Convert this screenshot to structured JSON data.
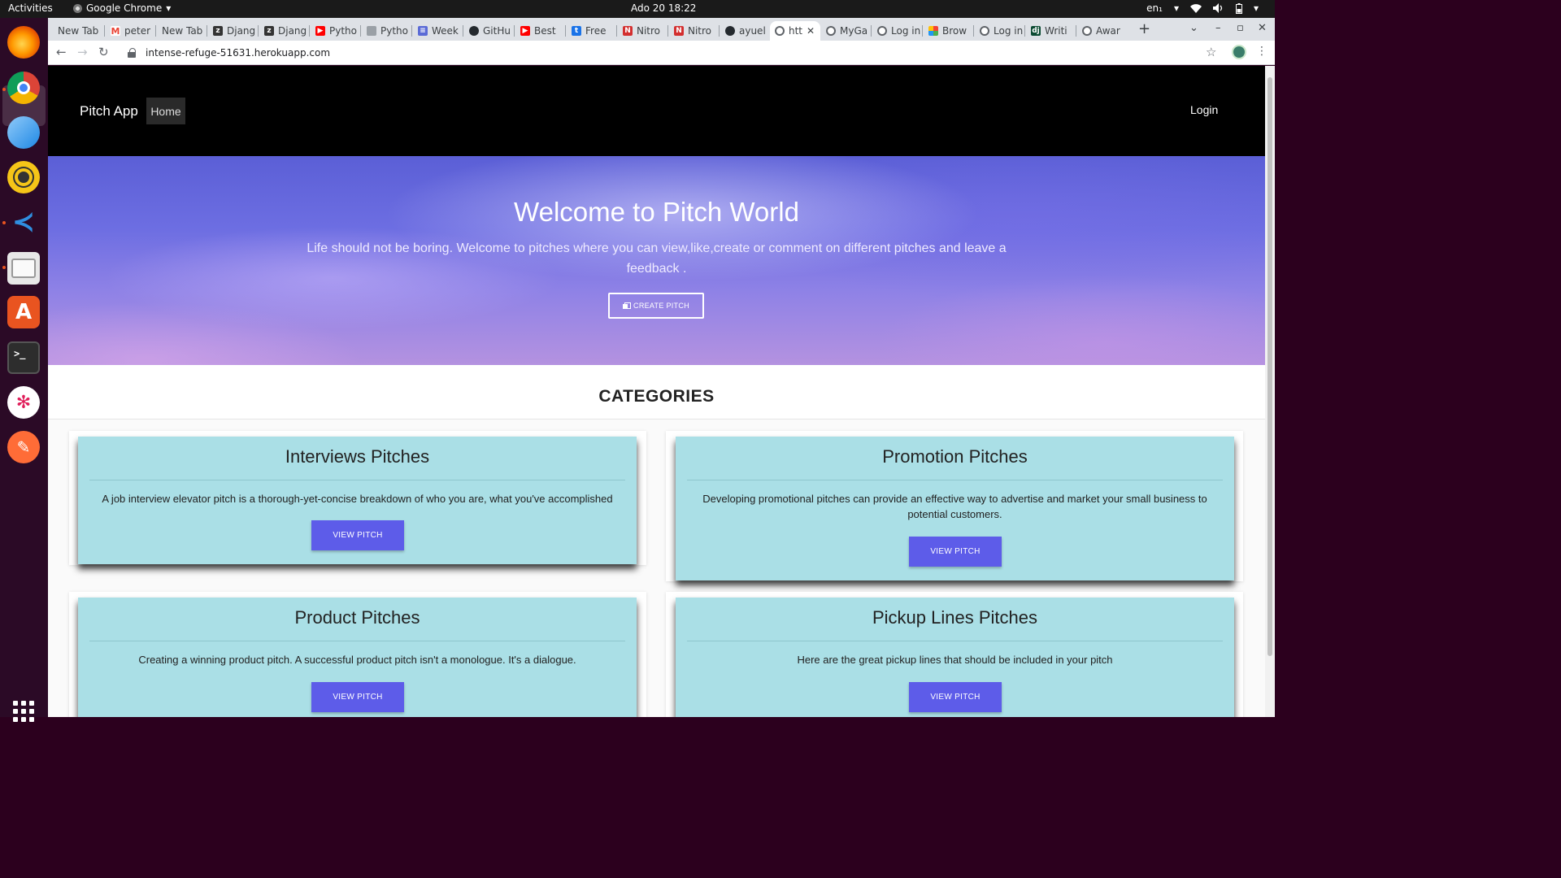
{
  "system_bar": {
    "activities": "Activities",
    "app_name": "Google Chrome",
    "clock": "Ado 20  18:22",
    "language": "en₁"
  },
  "browser": {
    "tabs": [
      {
        "label": "New Tab"
      },
      {
        "label": "peter"
      },
      {
        "label": "New Tab"
      },
      {
        "label": "Djang"
      },
      {
        "label": "Djang"
      },
      {
        "label": "Pytho"
      },
      {
        "label": "Pytho"
      },
      {
        "label": "Week"
      },
      {
        "label": "GitHu"
      },
      {
        "label": "Best"
      },
      {
        "label": "Free"
      },
      {
        "label": "Nitro"
      },
      {
        "label": "Nitro"
      },
      {
        "label": "ayuel"
      },
      {
        "label": "htt"
      },
      {
        "label": "MyGa"
      },
      {
        "label": "Log in"
      },
      {
        "label": "Brow"
      },
      {
        "label": "Log in"
      },
      {
        "label": "Writi"
      },
      {
        "label": "Awar"
      }
    ],
    "url": "intense-refuge-51631.herokuapp.com"
  },
  "site": {
    "brand": "Pitch App",
    "nav_home": "Home",
    "nav_login": "Login",
    "hero_title": "Welcome to Pitch World",
    "hero_subtitle": "Life should not be boring. Welcome to pitches where you can view,like,create or comment on different pitches and leave a feedback .",
    "hero_button": "CREATE PITCH",
    "categories_title": "CATEGORIES",
    "categories": [
      {
        "title": "Interviews Pitches",
        "description": "A job interview elevator pitch is a thorough-yet-concise breakdown of who you are, what you've accomplished",
        "button": "VIEW PITCH"
      },
      {
        "title": "Promotion Pitches",
        "description": "Developing promotional pitches can provide an effective way to advertise and market your small business to potential customers.",
        "button": "VIEW PITCH"
      },
      {
        "title": "Product Pitches",
        "description": "Creating a winning product pitch. A successful product pitch isn't a monologue. It's a dialogue.",
        "button": "VIEW PITCH"
      },
      {
        "title": "Pickup Lines Pitches",
        "description": "Here are the great pickup lines that should be included in your pitch",
        "button": "VIEW PITCH"
      }
    ]
  },
  "colors": {
    "navbar_bg": "#000000",
    "card_bg": "#aadfe6",
    "button_bg": "#5d5ce9"
  }
}
